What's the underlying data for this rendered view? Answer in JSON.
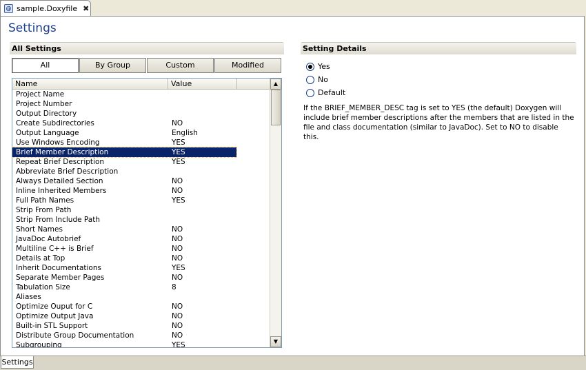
{
  "editor_tab": {
    "label": "sample.Doxyfile",
    "icon": "doxyfile-icon",
    "close_glyph": "✖"
  },
  "page_title": "Settings",
  "all_settings": {
    "header": "All Settings",
    "filters": [
      {
        "label": "All",
        "active": true
      },
      {
        "label": "By Group",
        "active": false
      },
      {
        "label": "Custom",
        "active": false
      },
      {
        "label": "Modified",
        "active": false
      }
    ],
    "columns": {
      "name": "Name",
      "value": "Value"
    },
    "rows": [
      {
        "name": "Project Name",
        "value": ""
      },
      {
        "name": "Project Number",
        "value": ""
      },
      {
        "name": "Output Directory",
        "value": ""
      },
      {
        "name": "Create Subdirectories",
        "value": "NO"
      },
      {
        "name": "Output Language",
        "value": "English"
      },
      {
        "name": "Use Windows Encoding",
        "value": "YES"
      },
      {
        "name": "Brief Member Description",
        "value": "YES",
        "selected": true
      },
      {
        "name": "Repeat Brief Description",
        "value": "YES"
      },
      {
        "name": "Abbreviate Brief Description",
        "value": ""
      },
      {
        "name": "Always Detailed Section",
        "value": "NO"
      },
      {
        "name": "Inline Inherited Members",
        "value": "NO"
      },
      {
        "name": "Full Path Names",
        "value": "YES"
      },
      {
        "name": "Strip From Path",
        "value": ""
      },
      {
        "name": "Strip From Include Path",
        "value": ""
      },
      {
        "name": "Short Names",
        "value": "NO"
      },
      {
        "name": "JavaDoc Autobrief",
        "value": "NO"
      },
      {
        "name": "Multiline C++ is Brief",
        "value": "NO"
      },
      {
        "name": "Details at Top",
        "value": "NO"
      },
      {
        "name": "Inherit Documentations",
        "value": "YES"
      },
      {
        "name": "Separate Member Pages",
        "value": "NO"
      },
      {
        "name": "Tabulation Size",
        "value": "8"
      },
      {
        "name": "Aliases",
        "value": ""
      },
      {
        "name": "Optimize Ouput for C",
        "value": "NO"
      },
      {
        "name": "Optimize Output Java",
        "value": "NO"
      },
      {
        "name": "Built-in STL Support",
        "value": "NO"
      },
      {
        "name": "Distribute Group Documentation",
        "value": "NO"
      },
      {
        "name": "Subgrouping",
        "value": "YES"
      }
    ],
    "scroll": {
      "up_glyph": "▲",
      "down_glyph": "▼"
    }
  },
  "setting_details": {
    "header": "Setting Details",
    "options": [
      {
        "label": "Yes",
        "checked": true
      },
      {
        "label": "No",
        "checked": false
      },
      {
        "label": "Default",
        "checked": false
      }
    ],
    "description": "If the BRIEF_MEMBER_DESC tag is set to YES (the default) Doxygen will include brief member descriptions after the members that are listed in the file and class documentation (similar to JavaDoc). Set to NO to disable this."
  },
  "bottom_tabs": [
    {
      "label": "Settings"
    }
  ],
  "colors": {
    "title": "#1c3f8a",
    "selection": "#0a246a",
    "chrome": "#ece9d8"
  }
}
